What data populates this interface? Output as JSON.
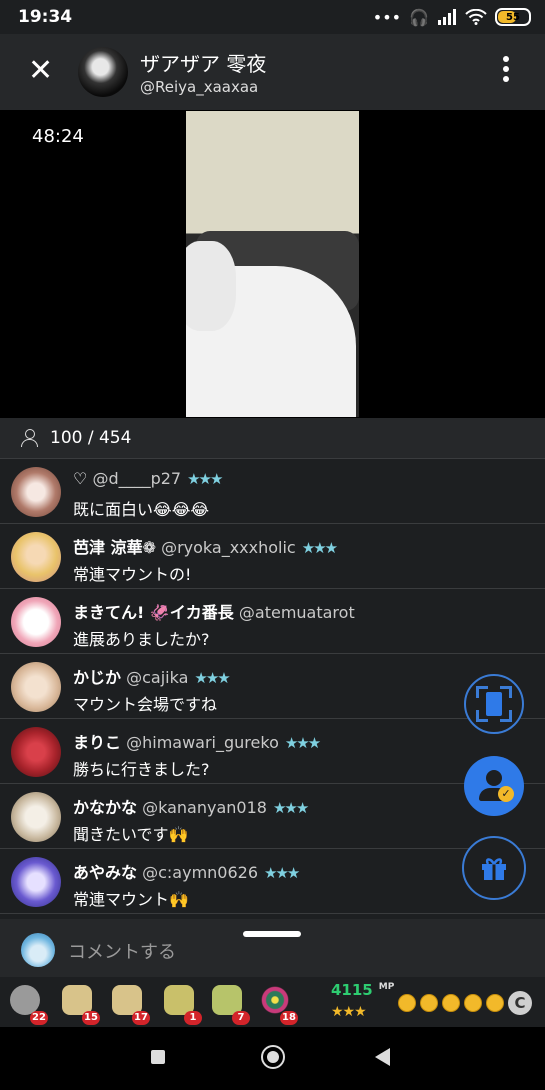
{
  "status_bar": {
    "time": "19:34",
    "battery": "55"
  },
  "header": {
    "name": "ザアザア 零夜",
    "handle": "@Reiya_xaaxaa"
  },
  "video": {
    "elapsed": "48:24"
  },
  "viewers": {
    "count": "100 / 454"
  },
  "comments": [
    {
      "name": "♡",
      "handle": "@d____p27",
      "stars": "★★★",
      "text": "既に面白い😂😂😂",
      "avatar_color": "#b07a6a"
    },
    {
      "name": "芭津 涼華❁",
      "handle": "@ryoka_xxxholic",
      "stars": "★★★",
      "text": "常連マウントの!",
      "avatar_color": "#e9c36a"
    },
    {
      "name": "まきてん! 🦑イカ番長",
      "handle": "@atemuatarot",
      "stars": "",
      "text": "進展ありましたか?",
      "avatar_color": "#f0a6b8"
    },
    {
      "name": "かじか",
      "handle": "@cajika",
      "stars": "★★★",
      "text": "マウント会場ですね",
      "avatar_color": "#d9b89a"
    },
    {
      "name": "まりこ",
      "handle": "@himawari_gureko",
      "stars": "★★★",
      "text": "勝ちに行きました?",
      "avatar_color": "#a8232b"
    },
    {
      "name": "かなかな",
      "handle": "@kananyan018",
      "stars": "★★★",
      "text": "聞きたいです🙌",
      "avatar_color": "#c9b9a0"
    },
    {
      "name": "あやみな",
      "handle": "@c:aymn0626",
      "stars": "★★★",
      "text": "常連マウント🙌",
      "avatar_color": "#6a5ad0"
    }
  ],
  "input": {
    "placeholder": "コメントする"
  },
  "gift_bar": {
    "items": [
      {
        "badge": "22",
        "color": "#9a9a9a"
      },
      {
        "badge": "15",
        "color": "#d8c38a"
      },
      {
        "badge": "17",
        "color": "#d8c38a"
      },
      {
        "badge": "1",
        "color": "#c9c06a"
      },
      {
        "badge": "7",
        "color": "#b7c46a"
      },
      {
        "badge": "18",
        "color": "#2d7a5a"
      }
    ],
    "mp_value": "4115",
    "mp_unit": "MP",
    "mp_stars": "★★★",
    "c_button": "C"
  }
}
